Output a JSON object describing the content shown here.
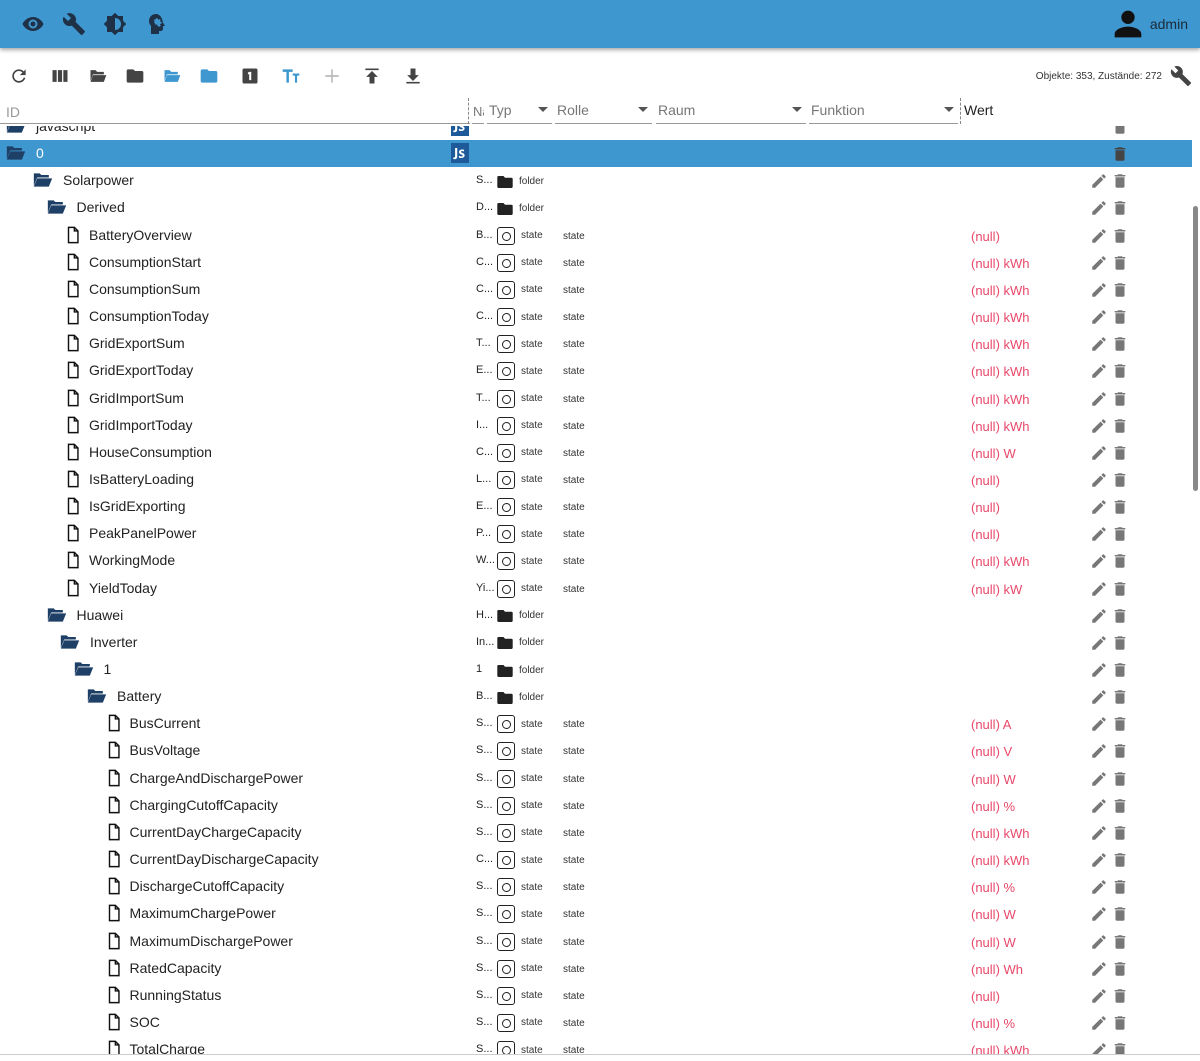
{
  "appbar": {
    "icons": [
      "eye-icon",
      "wrench-icon",
      "brightness-icon",
      "expert-mode-icon"
    ],
    "user_name": "admin"
  },
  "toolbar": {
    "buttons": [
      "refresh-icon",
      "columns-icon",
      "folder-open-icon",
      "folder-icon",
      "folder-open-blue-icon",
      "folder-blue-icon",
      "number-1-icon",
      "text-size-icon",
      "add-icon",
      "upload-icon",
      "download-icon"
    ],
    "stats": "Objekte: 353, Zustände: 272"
  },
  "columns": {
    "id_placeholder": "ID",
    "name": "Na",
    "type": "Typ",
    "role": "Rolle",
    "room": "Raum",
    "function": "Funktion",
    "value": "Wert"
  },
  "colors": {
    "accent": "#3f97cf",
    "null_value": "#e8486a",
    "icon_dark": "#1f3146"
  },
  "tree": [
    {
      "id": "javascript",
      "level": 0,
      "kind": "folder-js"
    },
    {
      "id": "0",
      "level": 0,
      "kind": "folder-js",
      "selected": true
    },
    {
      "id": "Solarpower",
      "level": 1,
      "kind": "folder",
      "name": "S...",
      "type": "folder"
    },
    {
      "id": "Derived",
      "level": 2,
      "kind": "folder",
      "name": "D...",
      "type": "folder"
    },
    {
      "id": "BatteryOverview",
      "level": 3,
      "kind": "state",
      "name": "B...",
      "type": "state",
      "role": "state",
      "value": "(null)"
    },
    {
      "id": "ConsumptionStart",
      "level": 3,
      "kind": "state",
      "name": "C...",
      "type": "state",
      "role": "state",
      "value": "(null) kWh"
    },
    {
      "id": "ConsumptionSum",
      "level": 3,
      "kind": "state",
      "name": "C...",
      "type": "state",
      "role": "state",
      "value": "(null) kWh"
    },
    {
      "id": "ConsumptionToday",
      "level": 3,
      "kind": "state",
      "name": "C...",
      "type": "state",
      "role": "state",
      "value": "(null) kWh"
    },
    {
      "id": "GridExportSum",
      "level": 3,
      "kind": "state",
      "name": "T...",
      "type": "state",
      "role": "state",
      "value": "(null) kWh"
    },
    {
      "id": "GridExportToday",
      "level": 3,
      "kind": "state",
      "name": "E...",
      "type": "state",
      "role": "state",
      "value": "(null) kWh"
    },
    {
      "id": "GridImportSum",
      "level": 3,
      "kind": "state",
      "name": "T...",
      "type": "state",
      "role": "state",
      "value": "(null) kWh"
    },
    {
      "id": "GridImportToday",
      "level": 3,
      "kind": "state",
      "name": "I...",
      "type": "state",
      "role": "state",
      "value": "(null) kWh"
    },
    {
      "id": "HouseConsumption",
      "level": 3,
      "kind": "state",
      "name": "C...",
      "type": "state",
      "role": "state",
      "value": "(null) W"
    },
    {
      "id": "IsBatteryLoading",
      "level": 3,
      "kind": "state",
      "name": "L...",
      "type": "state",
      "role": "state",
      "value": "(null)"
    },
    {
      "id": "IsGridExporting",
      "level": 3,
      "kind": "state",
      "name": "E...",
      "type": "state",
      "role": "state",
      "value": "(null)"
    },
    {
      "id": "PeakPanelPower",
      "level": 3,
      "kind": "state",
      "name": "P...",
      "type": "state",
      "role": "state",
      "value": "(null)"
    },
    {
      "id": "WorkingMode",
      "level": 3,
      "kind": "state",
      "name": "W...",
      "type": "state",
      "role": "state",
      "value": "(null) kWh"
    },
    {
      "id": "YieldToday",
      "level": 3,
      "kind": "state",
      "name": "Yi...",
      "type": "state",
      "role": "state",
      "value": "(null) kW"
    },
    {
      "id": "Huawei",
      "level": 2,
      "kind": "folder",
      "name": "H...",
      "type": "folder"
    },
    {
      "id": "Inverter",
      "level": 3,
      "kind": "folder",
      "name": "In...",
      "type": "folder"
    },
    {
      "id": "1",
      "level": 4,
      "kind": "folder",
      "name": "1",
      "type": "folder"
    },
    {
      "id": "Battery",
      "level": 5,
      "kind": "folder",
      "name": "B...",
      "type": "folder"
    },
    {
      "id": "BusCurrent",
      "level": 6,
      "kind": "state",
      "name": "S...",
      "type": "state",
      "role": "state",
      "value": "(null) A"
    },
    {
      "id": "BusVoltage",
      "level": 6,
      "kind": "state",
      "name": "S...",
      "type": "state",
      "role": "state",
      "value": "(null) V"
    },
    {
      "id": "ChargeAndDischargePower",
      "level": 6,
      "kind": "state",
      "name": "S...",
      "type": "state",
      "role": "state",
      "value": "(null) W"
    },
    {
      "id": "ChargingCutoffCapacity",
      "level": 6,
      "kind": "state",
      "name": "S...",
      "type": "state",
      "role": "state",
      "value": "(null) %"
    },
    {
      "id": "CurrentDayChargeCapacity",
      "level": 6,
      "kind": "state",
      "name": "S...",
      "type": "state",
      "role": "state",
      "value": "(null) kWh"
    },
    {
      "id": "CurrentDayDischargeCapacity",
      "level": 6,
      "kind": "state",
      "name": "C...",
      "type": "state",
      "role": "state",
      "value": "(null) kWh"
    },
    {
      "id": "DischargeCutoffCapacity",
      "level": 6,
      "kind": "state",
      "name": "S...",
      "type": "state",
      "role": "state",
      "value": "(null) %"
    },
    {
      "id": "MaximumChargePower",
      "level": 6,
      "kind": "state",
      "name": "S...",
      "type": "state",
      "role": "state",
      "value": "(null) W"
    },
    {
      "id": "MaximumDischargePower",
      "level": 6,
      "kind": "state",
      "name": "S...",
      "type": "state",
      "role": "state",
      "value": "(null) W"
    },
    {
      "id": "RatedCapacity",
      "level": 6,
      "kind": "state",
      "name": "S...",
      "type": "state",
      "role": "state",
      "value": "(null) Wh"
    },
    {
      "id": "RunningStatus",
      "level": 6,
      "kind": "state",
      "name": "S...",
      "type": "state",
      "role": "state",
      "value": "(null)"
    },
    {
      "id": "SOC",
      "level": 6,
      "kind": "state",
      "name": "S...",
      "type": "state",
      "role": "state",
      "value": "(null) %"
    },
    {
      "id": "TotalCharge",
      "level": 6,
      "kind": "state",
      "name": "S...",
      "type": "state",
      "role": "state",
      "value": "(null) kWh"
    }
  ]
}
